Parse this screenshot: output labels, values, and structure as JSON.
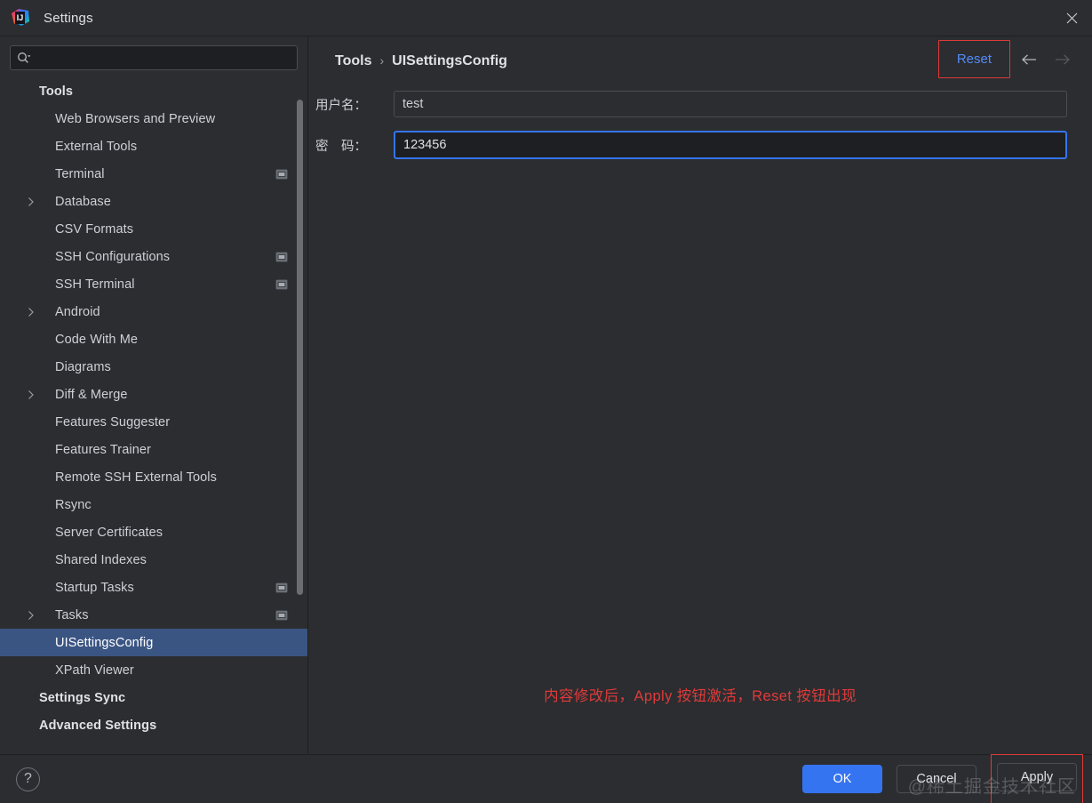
{
  "window": {
    "title": "Settings",
    "logo_icon": "intellij-idea-logo",
    "close_icon": "close-icon"
  },
  "search": {
    "value": "",
    "placeholder": "",
    "icon": "search-icon"
  },
  "sidebar": {
    "scope_icon": "project-scope-icon",
    "expand_icon": "chevron-right-icon",
    "items": [
      {
        "label": "Tools",
        "level": 0,
        "expandable": false,
        "scoped": false,
        "selected": false
      },
      {
        "label": "Web Browsers and Preview",
        "level": 1,
        "expandable": false,
        "scoped": false,
        "selected": false
      },
      {
        "label": "External Tools",
        "level": 1,
        "expandable": false,
        "scoped": false,
        "selected": false
      },
      {
        "label": "Terminal",
        "level": 1,
        "expandable": false,
        "scoped": true,
        "selected": false
      },
      {
        "label": "Database",
        "level": 1,
        "expandable": true,
        "scoped": false,
        "selected": false
      },
      {
        "label": "CSV Formats",
        "level": 1,
        "expandable": false,
        "scoped": false,
        "selected": false
      },
      {
        "label": "SSH Configurations",
        "level": 1,
        "expandable": false,
        "scoped": true,
        "selected": false
      },
      {
        "label": "SSH Terminal",
        "level": 1,
        "expandable": false,
        "scoped": true,
        "selected": false
      },
      {
        "label": "Android",
        "level": 1,
        "expandable": true,
        "scoped": false,
        "selected": false
      },
      {
        "label": "Code With Me",
        "level": 1,
        "expandable": false,
        "scoped": false,
        "selected": false
      },
      {
        "label": "Diagrams",
        "level": 1,
        "expandable": false,
        "scoped": false,
        "selected": false
      },
      {
        "label": "Diff & Merge",
        "level": 1,
        "expandable": true,
        "scoped": false,
        "selected": false
      },
      {
        "label": "Features Suggester",
        "level": 1,
        "expandable": false,
        "scoped": false,
        "selected": false
      },
      {
        "label": "Features Trainer",
        "level": 1,
        "expandable": false,
        "scoped": false,
        "selected": false
      },
      {
        "label": "Remote SSH External Tools",
        "level": 1,
        "expandable": false,
        "scoped": false,
        "selected": false
      },
      {
        "label": "Rsync",
        "level": 1,
        "expandable": false,
        "scoped": false,
        "selected": false
      },
      {
        "label": "Server Certificates",
        "level": 1,
        "expandable": false,
        "scoped": false,
        "selected": false
      },
      {
        "label": "Shared Indexes",
        "level": 1,
        "expandable": false,
        "scoped": false,
        "selected": false
      },
      {
        "label": "Startup Tasks",
        "level": 1,
        "expandable": false,
        "scoped": true,
        "selected": false
      },
      {
        "label": "Tasks",
        "level": 1,
        "expandable": true,
        "scoped": true,
        "selected": false
      },
      {
        "label": "UISettingsConfig",
        "level": 1,
        "expandable": false,
        "scoped": false,
        "selected": true
      },
      {
        "label": "XPath Viewer",
        "level": 1,
        "expandable": false,
        "scoped": false,
        "selected": false
      },
      {
        "label": "Settings Sync",
        "level": 0,
        "expandable": false,
        "scoped": false,
        "selected": false
      },
      {
        "label": "Advanced Settings",
        "level": 0,
        "expandable": false,
        "scoped": false,
        "selected": false
      }
    ]
  },
  "main": {
    "breadcrumb": {
      "root": "Tools",
      "separator": "›",
      "leaf": "UISettingsConfig"
    },
    "reset_label": "Reset",
    "back_icon": "arrow-left-icon",
    "forward_icon": "arrow-right-icon",
    "form": {
      "username": {
        "label": "用户名：",
        "value": "test",
        "placeholder": ""
      },
      "password": {
        "label": "密　码：",
        "value": "123456",
        "placeholder": ""
      }
    },
    "annotation": "内容修改后，Apply 按钮激活，Reset 按钮出现"
  },
  "footer": {
    "help_label": "?",
    "ok_label": "OK",
    "cancel_label": "Cancel",
    "apply_label": "Apply"
  },
  "watermark": "@稀土掘金技术社区",
  "colors": {
    "window_bg": "#2b2d30",
    "field_bg": "#1e1f22",
    "selection_blue": "#3b5583",
    "accent_blue": "#3574f0",
    "link_blue": "#548af7",
    "annotation_red": "#e03a3a",
    "text": "#ced0d6"
  }
}
